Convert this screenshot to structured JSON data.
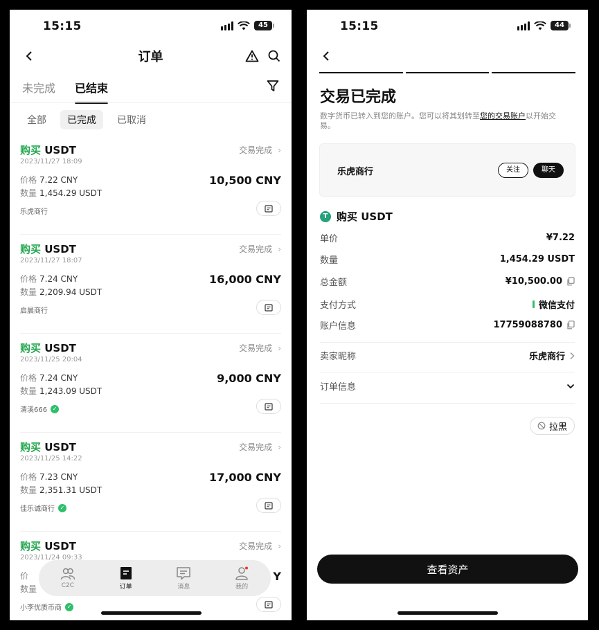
{
  "left": {
    "status": {
      "time": "15:15",
      "battery": "45"
    },
    "header": {
      "title": "订单"
    },
    "tabs": [
      {
        "label": "未完成"
      },
      {
        "label": "已结束"
      }
    ],
    "chips": [
      {
        "label": "全部"
      },
      {
        "label": "已完成"
      },
      {
        "label": "已取消"
      }
    ],
    "orders": [
      {
        "buy": "购买",
        "asset": "USDT",
        "status": "交易完成",
        "time": "2023/11/27 18:09",
        "price_label": "价格",
        "price": "7.22 CNY",
        "qty_label": "数量",
        "qty": "1,454.29 USDT",
        "amount": "10,500 CNY",
        "merchant": "乐虎商行",
        "verified": false
      },
      {
        "buy": "购买",
        "asset": "USDT",
        "status": "交易完成",
        "time": "2023/11/27 18:07",
        "price_label": "价格",
        "price": "7.24 CNY",
        "qty_label": "数量",
        "qty": "2,209.94 USDT",
        "amount": "16,000 CNY",
        "merchant": "启晨商行",
        "verified": false
      },
      {
        "buy": "购买",
        "asset": "USDT",
        "status": "交易完成",
        "time": "2023/11/25 20:04",
        "price_label": "价格",
        "price": "7.24 CNY",
        "qty_label": "数量",
        "qty": "1,243.09 USDT",
        "amount": "9,000 CNY",
        "merchant": "清溪666",
        "verified": true
      },
      {
        "buy": "购买",
        "asset": "USDT",
        "status": "交易完成",
        "time": "2023/11/25 14:22",
        "price_label": "价格",
        "price": "7.23 CNY",
        "qty_label": "数量",
        "qty": "2,351.31 USDT",
        "amount": "17,000 CNY",
        "merchant": "佳乐诚商行",
        "verified": true
      },
      {
        "buy": "购买",
        "asset": "USDT",
        "status": "交易完成",
        "time": "2023/11/24 09:33",
        "price_label": "价",
        "price": "",
        "qty_label": "数量",
        "qty": "",
        "amount": "Y",
        "merchant": "小李优质币商",
        "verified": true
      }
    ],
    "nav": [
      {
        "label": "C2C",
        "icon": "users-icon"
      },
      {
        "label": "订单",
        "icon": "orders-icon"
      },
      {
        "label": "消息",
        "icon": "message-icon"
      },
      {
        "label": "我的",
        "icon": "profile-icon"
      }
    ]
  },
  "right": {
    "status": {
      "time": "15:15",
      "battery": "44"
    },
    "title": "交易已完成",
    "desc_before": "数字货币已转入到您的账户。您可以将其划转至",
    "desc_link": "您的交易账户",
    "desc_after": "以开始交易。",
    "merchant": {
      "name": "乐虎商行",
      "follow": "关注",
      "chat": "聊天"
    },
    "asset_title": "购买 USDT",
    "asset_icon": "T",
    "rows": {
      "unit_price": {
        "k": "单价",
        "v": "¥7.22"
      },
      "quantity": {
        "k": "数量",
        "v": "1,454.29 USDT"
      },
      "total": {
        "k": "总金额",
        "v": "¥10,500.00"
      },
      "payment": {
        "k": "支付方式",
        "v": "微信支付"
      },
      "account": {
        "k": "账户信息",
        "v": "17759088780"
      },
      "seller": {
        "k": "卖家昵称",
        "v": "乐虎商行"
      },
      "order_info": {
        "k": "订单信息"
      }
    },
    "blacklist": "拉黑",
    "view_assets": "查看资产"
  },
  "colors": {
    "buy_green": "#25a750",
    "primary": "#111111",
    "verified": "#2fbf6a",
    "usdt": "#26a17b"
  }
}
